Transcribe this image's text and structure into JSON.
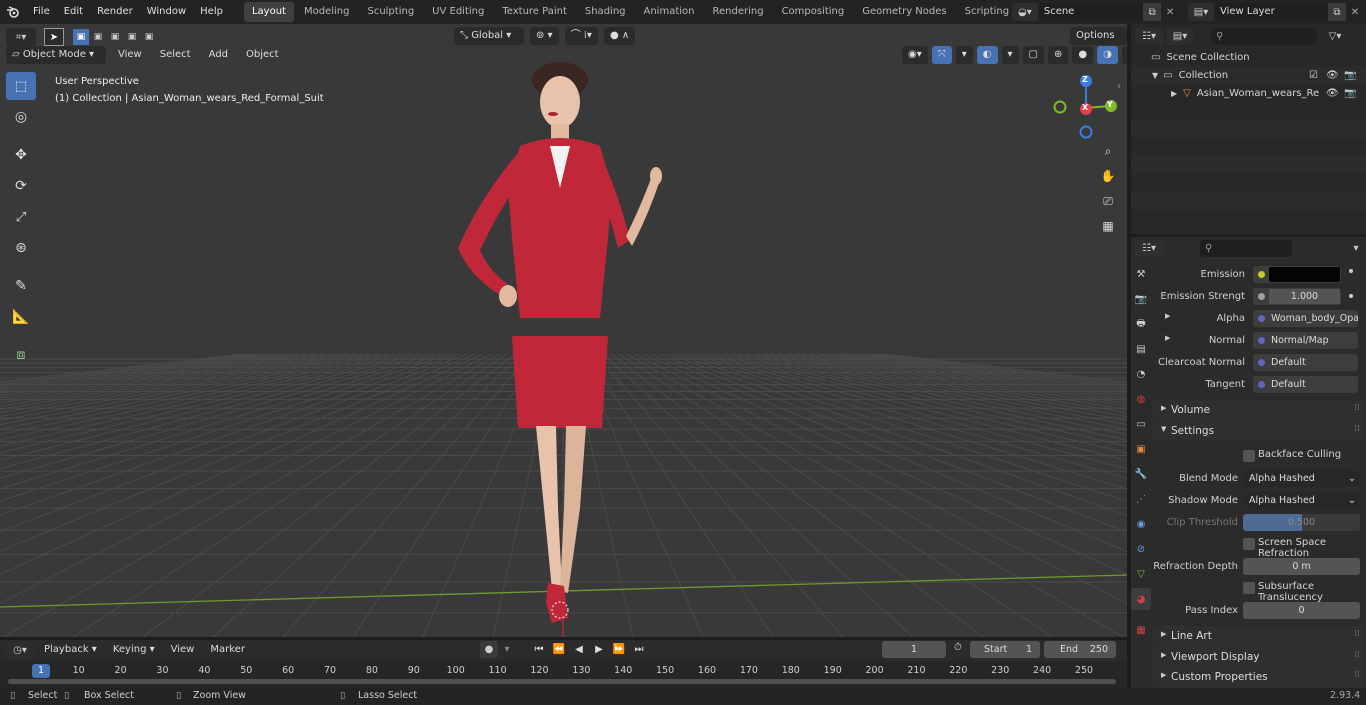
{
  "menu": {
    "items": [
      "File",
      "Edit",
      "Render",
      "Window",
      "Help"
    ]
  },
  "workspaces": [
    "Layout",
    "Modeling",
    "Sculpting",
    "UV Editing",
    "Texture Paint",
    "Shading",
    "Animation",
    "Rendering",
    "Compositing",
    "Geometry Nodes",
    "Scripting"
  ],
  "active_workspace": "Layout",
  "scene": {
    "name": "Scene",
    "view_layer": "View Layer"
  },
  "viewport": {
    "mode": "Object Mode",
    "menus": [
      "View",
      "Select",
      "Add",
      "Object"
    ],
    "transform_orientation": "Global",
    "options_label": "Options",
    "overlay_title": "User Perspective",
    "overlay_subtitle": "(1) Collection | Asian_Woman_wears_Red_Formal_Suit",
    "gizmo": {
      "x": "X",
      "y": "Y",
      "z": "Z"
    }
  },
  "outliner": {
    "scene_collection": "Scene Collection",
    "collection": "Collection",
    "object": "Asian_Woman_wears_Re"
  },
  "properties": {
    "rows": [
      {
        "label": "Emission",
        "value": "",
        "dot": "#c7c729"
      },
      {
        "label": "Emission Strengt",
        "value": "1.000",
        "dot": "#a0a0a0"
      },
      {
        "label": "Alpha",
        "value": "Woman_body_Opac...",
        "dot": "#6363c7"
      },
      {
        "label": "Normal",
        "value": "Normal/Map",
        "dot": "#6363c7"
      },
      {
        "label": "Clearcoat Normal",
        "value": "Default",
        "dot": "#6363c7"
      },
      {
        "label": "Tangent",
        "value": "Default",
        "dot": "#6363c7"
      }
    ],
    "volume": "Volume",
    "settings": "Settings",
    "backface_culling": "Backface Culling",
    "blend_mode_label": "Blend Mode",
    "blend_mode": "Alpha Hashed",
    "shadow_mode_label": "Shadow Mode",
    "shadow_mode": "Alpha Hashed",
    "clip_threshold_label": "Clip Threshold",
    "clip_threshold": "0.500",
    "clip_threshold_fraction": 0.5,
    "screen_space_refraction": "Screen Space Refraction",
    "refraction_depth_label": "Refraction Depth",
    "refraction_depth": "0 m",
    "subsurface_translucency": "Subsurface Translucency",
    "pass_index_label": "Pass Index",
    "pass_index": "0",
    "line_art": "Line Art",
    "viewport_display": "Viewport Display",
    "custom_properties": "Custom Properties"
  },
  "timeline": {
    "menus": [
      "Playback",
      "Keying",
      "View",
      "Marker"
    ],
    "current_frame": "1",
    "start_label": "Start",
    "start": "1",
    "end_label": "End",
    "end": "250",
    "ticks": [
      "1",
      "10",
      "20",
      "30",
      "40",
      "50",
      "60",
      "70",
      "80",
      "90",
      "100",
      "110",
      "120",
      "130",
      "140",
      "150",
      "160",
      "170",
      "180",
      "190",
      "200",
      "210",
      "220",
      "230",
      "240",
      "250"
    ]
  },
  "statusbar": {
    "select": "Select",
    "box_select": "Box Select",
    "zoom_view": "Zoom View",
    "lasso_select": "Lasso Select",
    "version": "2.93.4"
  },
  "colors": {
    "accent": "#4772b3",
    "outfit": "#c0283a",
    "x_axis": "#e5414b",
    "y_axis": "#7fb92c",
    "z_axis": "#3b7de0"
  }
}
